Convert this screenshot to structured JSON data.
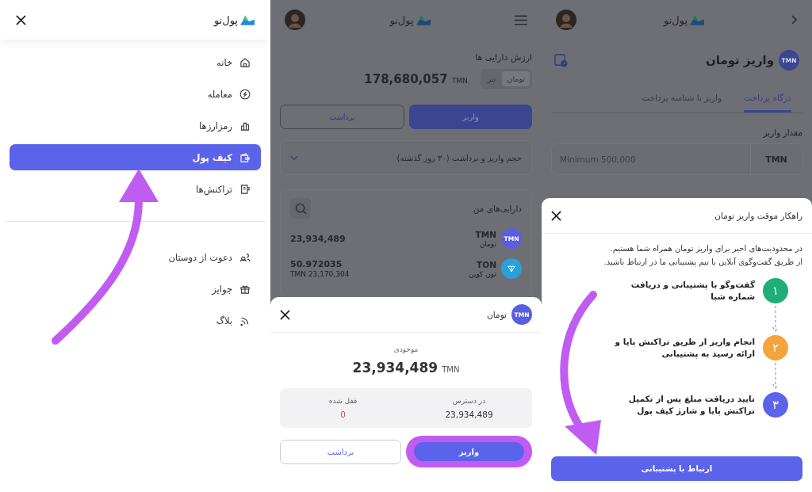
{
  "menu_screen": {
    "logo": "پول‌نو",
    "items": [
      {
        "label": "خانه",
        "selected": false
      },
      {
        "label": "معامله",
        "selected": false
      },
      {
        "label": "رمزارزها",
        "selected": false
      },
      {
        "label": "کیف پول",
        "selected": true
      },
      {
        "label": "تراکنش‌ها",
        "selected": false
      }
    ],
    "secondary_items": [
      {
        "label": "دعوت از دوستان",
        "selected": false
      },
      {
        "label": "جوایز",
        "selected": false
      },
      {
        "label": "بلاگ",
        "selected": false
      }
    ]
  },
  "wallet_screen": {
    "logo": "پول‌نو",
    "title": "ارزش دارایی ها",
    "currency_toggle": [
      {
        "label": "تومان",
        "selected": true
      },
      {
        "label": "تتر",
        "selected": false
      }
    ],
    "total": {
      "unit": "TMN",
      "amount": "178,680,057"
    },
    "deposit_button": "واریز",
    "withdraw_button": "برداشت",
    "volume_panel": "حجم واریز و برداشت (۳۰ روز گذشته)",
    "assets": {
      "title": "دارایی‌های من",
      "rows": [
        {
          "symbol": "TMN",
          "name": "تومان",
          "amount": "23,934,489",
          "badge": "TMN",
          "color": "#5a5fe0"
        },
        {
          "symbol": "TON",
          "name": "تون کوین",
          "amount": "50.972035",
          "value": "TMN 23,170,304",
          "color": "#2aa0d8"
        }
      ]
    },
    "sheet": {
      "title": "تومان",
      "badge": "TMN",
      "balance_label": "موجودی",
      "balance": {
        "unit": "TMN",
        "amount": "23,934,489"
      },
      "available": {
        "label": "در دسترس",
        "value": "23,934,489"
      },
      "locked": {
        "label": "قفل شده",
        "value": "0"
      },
      "deposit_button": "واریز",
      "withdraw_button": "برداشت"
    }
  },
  "deposit_screen": {
    "logo": "پول‌نو",
    "title": "واریز تومان",
    "badge": "TMN",
    "tabs": [
      {
        "label": "درگاه پرداخت",
        "selected": true
      },
      {
        "label": "واریز با شناسه پرداخت",
        "selected": false
      }
    ],
    "amount_label": "مقدار واریز",
    "amount_field": {
      "unit": "TMN",
      "placeholder": "Minimum 500,000"
    },
    "sheet": {
      "title": "راهکار موقت واریز تومان",
      "intro_lines": [
        "در محدودیت‌های اخیر برای واریز تومان همراه شما هستیم.",
        "از طریق گفت‌وگوی آنلاین با تیم پشتیبانی ما در ارتباط باشید."
      ],
      "steps": [
        {
          "number": "۱",
          "text": "گفت‌وگو با پشتیبانی و دریافت شماره شبا",
          "color": "#1fae78"
        },
        {
          "number": "۲",
          "text": "انجام واریز از طریق تراکنش پایا و ارائه رسید به پشتیبانی",
          "color": "#f5a33b"
        },
        {
          "number": "۳",
          "text": "تایید دریافت مبلغ پس از تکمیل تراکنش پایا و شارژ کیف پول",
          "color": "#5b63e8"
        }
      ],
      "button": "ارتباط با پشتیبانی"
    }
  }
}
